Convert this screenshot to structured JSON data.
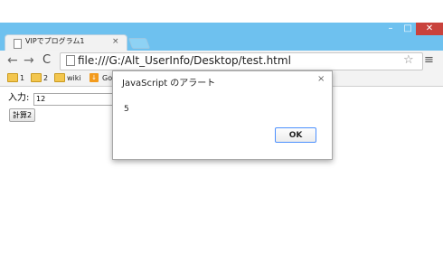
{
  "window": {
    "controls": {
      "minimize_glyph": "–",
      "maximize_glyph": "□",
      "close_glyph": "✕"
    }
  },
  "tabs": [
    {
      "title": "VIPでプログラム1",
      "close_glyph": "×",
      "icon": "page-icon"
    }
  ],
  "toolbar": {
    "back_glyph": "←",
    "forward_glyph": "→",
    "reload_glyph": "C",
    "url": "file:///G:/Alt_UserInfo/Desktop/test.html",
    "star_glyph": "☆",
    "menu_glyph": "≡"
  },
  "bookmarks": [
    {
      "label": "1",
      "icon": "folder-icon"
    },
    {
      "label": "2",
      "icon": "folder-icon"
    },
    {
      "label": "wiki",
      "icon": "folder-icon"
    },
    {
      "label": "Go",
      "icon": "download-icon",
      "icon_glyph": "↓"
    }
  ],
  "page": {
    "input_label": "入力:",
    "input_value": "12",
    "button_label": "計算2"
  },
  "dialog": {
    "title": "JavaScript のアラート",
    "close_glyph": "×",
    "message": "5",
    "ok_label": "OK"
  },
  "colors": {
    "frame": "#6ec1ef",
    "close_button": "#c9423c",
    "ok_button_border": "#4d90fe"
  }
}
